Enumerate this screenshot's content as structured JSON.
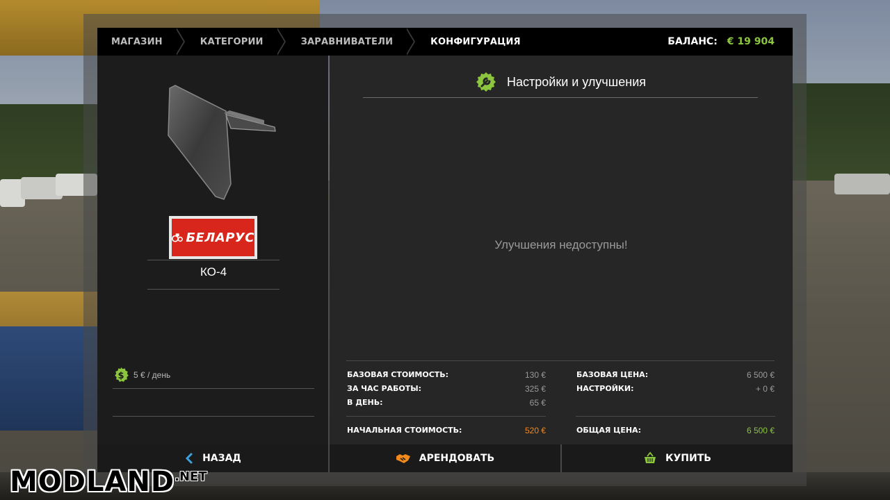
{
  "breadcrumb": [
    "МАГАЗИН",
    "КАТЕГОРИИ",
    "ЗАРАВНИВАТЕЛИ",
    "КОНФИГУРАЦИЯ"
  ],
  "balance": {
    "label": "БАЛАНС:",
    "value": "€ 19 904"
  },
  "item": {
    "brand": "БЕЛАРУС",
    "name": "КО-4",
    "rent": "5 € / день",
    "image_icon": "plow-blade-icon"
  },
  "section": {
    "title": "Настройки и улучшения",
    "empty_message": "Улучшения недоступны!"
  },
  "costs": {
    "base_cost_label": "БАЗОВАЯ СТОИМОСТЬ:",
    "base_cost": "130 €",
    "per_hour_label": "ЗА ЧАС РАБОТЫ:",
    "per_hour": "325 €",
    "per_day_label": "В ДЕНЬ:",
    "per_day": "65 €",
    "initial_cost_label": "НАЧАЛЬНАЯ СТОИМОСТЬ:",
    "initial_cost": "520 €",
    "base_price_label": "БАЗОВАЯ ЦЕНА:",
    "base_price": "6 500 €",
    "settings_label": "НАСТРОЙКИ:",
    "settings": "+ 0 €",
    "total_label": "ОБЩАЯ ЦЕНА:",
    "total": "6 500 €"
  },
  "buttons": {
    "back": "НАЗАД",
    "lease": "АРЕНДОВАТЬ",
    "buy": "КУПИТЬ"
  },
  "watermark": {
    "main": "MODLAND",
    "suffix": ".NET"
  },
  "colors": {
    "accent_green": "#8cc63e",
    "accent_orange": "#f08a1c",
    "brand_red": "#d8261c"
  }
}
